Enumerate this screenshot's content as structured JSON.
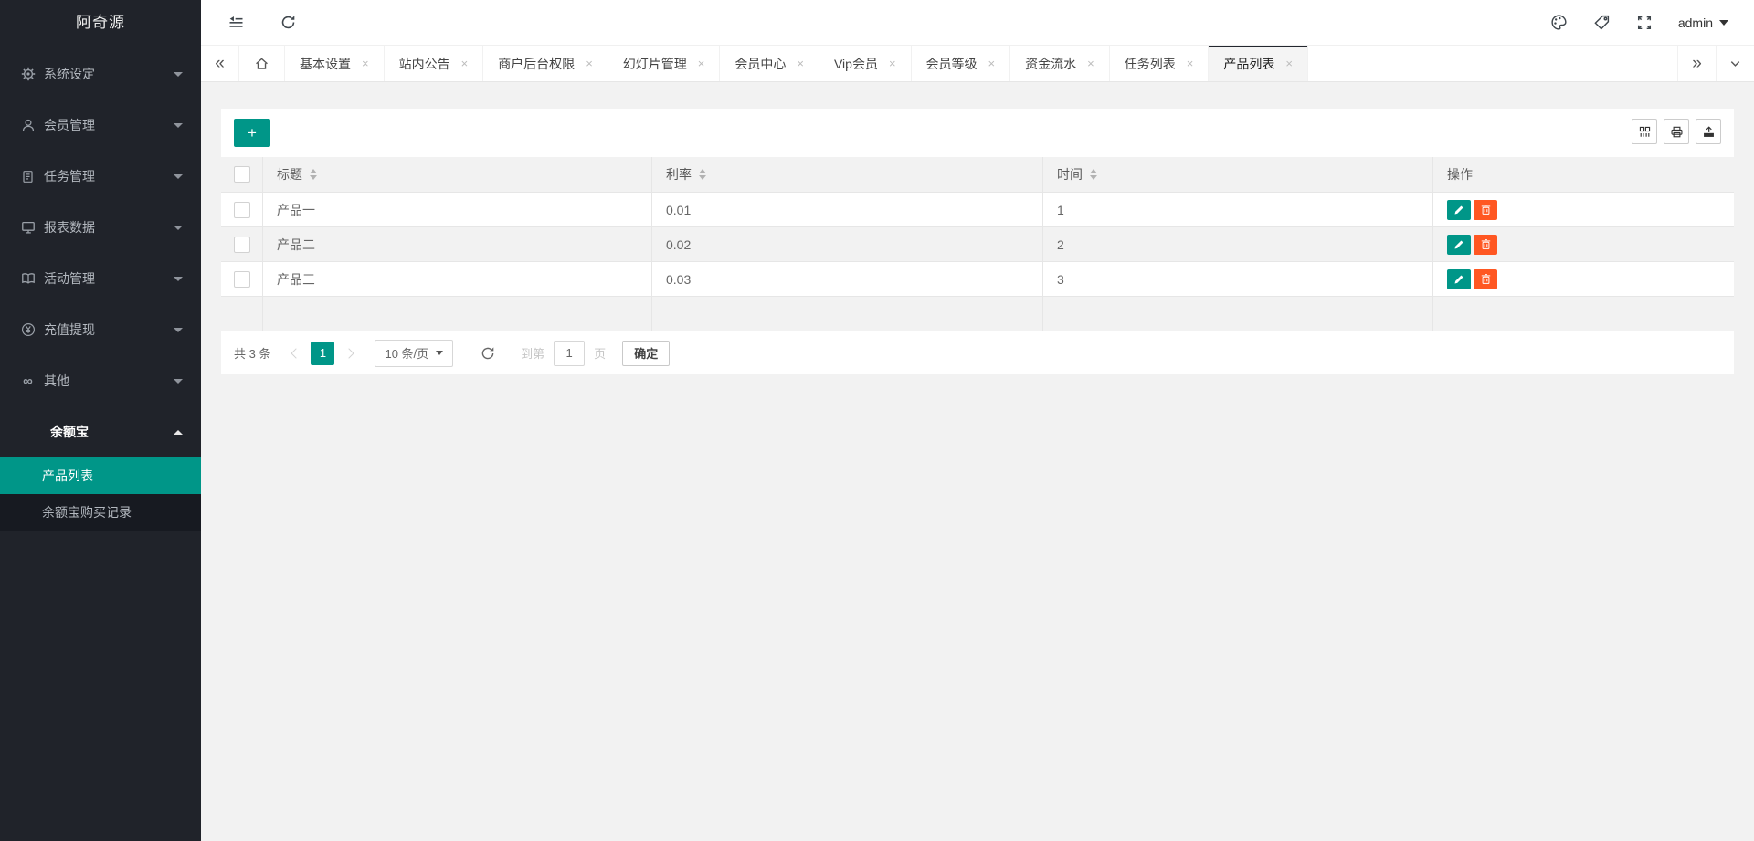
{
  "brand": "阿奇源",
  "topbar": {
    "user": "admin"
  },
  "tabbar": {
    "tabs": [
      "基本设置",
      "站内公告",
      "商户后台权限",
      "幻灯片管理",
      "会员中心",
      "Vip会员",
      "会员等级",
      "资金流水",
      "任务列表",
      "产品列表"
    ],
    "active": "产品列表"
  },
  "sidebar": {
    "items": [
      "系统设定",
      "会员管理",
      "任务管理",
      "报表数据",
      "活动管理",
      "充值提现",
      "其他",
      "余额宝"
    ],
    "submenu": [
      "产品列表",
      "余额宝购买记录"
    ]
  },
  "toolbar": {
    "add_label": "+"
  },
  "table": {
    "columns": [
      "标题",
      "利率",
      "时间",
      "操作"
    ],
    "rows": [
      {
        "title": "产品一",
        "rate": "0.01",
        "time": "1"
      },
      {
        "title": "产品二",
        "rate": "0.02",
        "time": "2"
      },
      {
        "title": "产品三",
        "rate": "0.03",
        "time": "3"
      }
    ]
  },
  "pagination": {
    "total": "共 3 条",
    "current_page": "1",
    "page_size": "10 条/页",
    "jump_prefix": "到第",
    "jump_value": "1",
    "jump_suffix": "页",
    "confirm_label": "确定"
  },
  "icons": {
    "close": "×",
    "collapse_left": "«",
    "expand_right": "»"
  },
  "colors": {
    "accent": "#009688",
    "danger": "#FF5722",
    "sidebar_bg": "#20232A",
    "submenu_bg": "#171A21",
    "content_bg": "#F2F2F2"
  }
}
